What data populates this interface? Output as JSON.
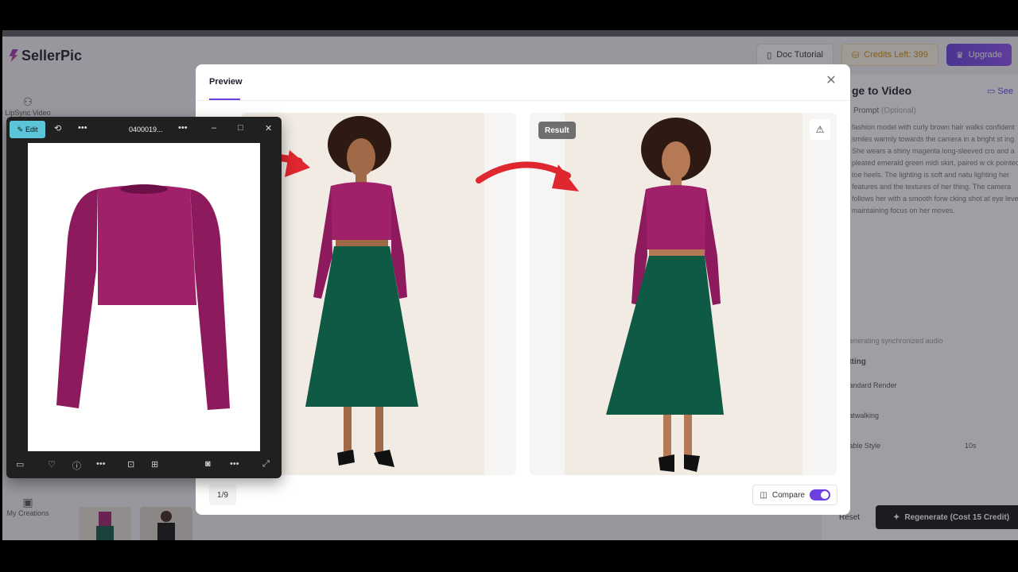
{
  "app": {
    "name": "SellerPic"
  },
  "header": {
    "doc_tutorial": "Doc Tutorial",
    "credits": "Credits Left: 399",
    "upgrade": "Upgrade"
  },
  "sidebar": {
    "items": [
      {
        "label": "LipSync Video"
      },
      {
        "label": "My Creations"
      }
    ]
  },
  "right_panel": {
    "title": "ge to Video",
    "see": "See",
    "prompt_label": "Prompt",
    "prompt_optional": "(Optional)",
    "prompt_text": "fashion model with curly brown hair walks confident smiles warmly towards the camera in a bright st ing. She wears a shiny magenta long-sleeved cro and a pleated emerald green midi skirt, paired w ck pointed-toe heels. The lighting is soft and natu lighting her features and the textures of her thing. The camera follows her with a smooth forw cking shot at eye level, maintaining focus on her moves.",
    "audio_note": "to generating synchronized audio",
    "setting_label": "Setting",
    "render": "Standard Render",
    "motion": "Catwalking",
    "style": "Stable Style",
    "duration": "10s",
    "reset": "Reset",
    "regenerate": "Regenerate (Cost 15 Credit)"
  },
  "modal": {
    "title": "Preview",
    "result_badge": "Result",
    "counter": "1/9",
    "compare_label": "Compare",
    "compare_on": true
  },
  "viewer": {
    "edit_label": "Edit",
    "file_name": "0400019...",
    "minimize": "–",
    "maximize": "□",
    "close": "✕"
  },
  "colors": {
    "accent": "#6b3fe0",
    "arrow": "#e0262f",
    "top": "#a0206a",
    "skirt": "#0e5a44"
  }
}
